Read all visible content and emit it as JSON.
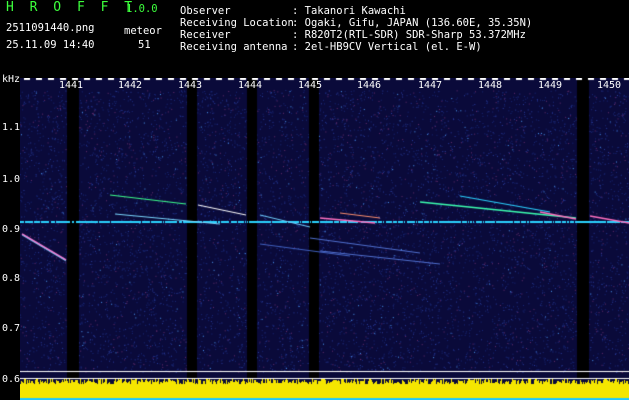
{
  "app": {
    "title": "H R O F F T",
    "version": "1.0.0"
  },
  "file": {
    "name": "2511091440.png",
    "datetime": "25.11.09 14:40"
  },
  "meteor": {
    "label": "meteor",
    "count": "51"
  },
  "info": [
    {
      "key": "Observer",
      "value": ": Takanori Kawachi"
    },
    {
      "key": "Receiving Location",
      "value": ": Ogaki, Gifu, JAPAN (136.60E, 35.35N)"
    },
    {
      "key": "Receiver",
      "value": ": R820T2(RTL-SDR) SDR-Sharp 53.372MHz"
    },
    {
      "key": "Receiving antenna",
      "value": ": 2el-HB9CV Vertical (el. E-W)"
    }
  ],
  "yaxis": {
    "unit": "kHz",
    "ticks": [
      "1.1",
      "1.0",
      "0.9",
      "0.8",
      "0.7",
      "0.6"
    ]
  },
  "xaxis": {
    "ticks": [
      "1441",
      "1442",
      "1443",
      "1444",
      "1445",
      "1446",
      "1447",
      "1448",
      "1449",
      "1450"
    ]
  },
  "colors": {
    "background": "#0a0a3a",
    "title": "#3cff3c",
    "signal": "#2ad2ff",
    "level_bar": "#f5e600"
  }
}
